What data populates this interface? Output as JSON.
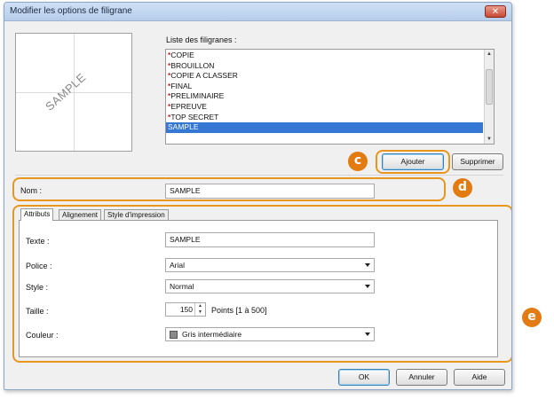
{
  "dialog": {
    "title": "Modifier les options de filigrane",
    "close_label": "✕"
  },
  "preview": {
    "watermark_text": "SAMPLE"
  },
  "watermark_list": {
    "label": "Liste des filigranes :",
    "items": [
      {
        "star": "*",
        "text": "COPIE"
      },
      {
        "star": "*",
        "text": "BROUILLON"
      },
      {
        "star": "*",
        "text": "COPIE A CLASSER"
      },
      {
        "star": "*",
        "text": "FINAL"
      },
      {
        "star": "*",
        "text": "PRELIMINAIRE"
      },
      {
        "star": "*",
        "text": "EPREUVE"
      },
      {
        "star": "*",
        "text": "TOP SECRET"
      },
      {
        "star": "",
        "text": "SAMPLE"
      }
    ],
    "selected_index": 7
  },
  "buttons": {
    "add": "Ajouter",
    "delete": "Supprimer",
    "ok": "OK",
    "cancel": "Annuler",
    "help": "Aide"
  },
  "badges": {
    "c": "c",
    "d": "d",
    "e": "e"
  },
  "name_field": {
    "label": "Nom :",
    "value": "SAMPLE"
  },
  "tabs": [
    {
      "label": "Attributs"
    },
    {
      "label": "Alignement"
    },
    {
      "label": "Style d'impression"
    }
  ],
  "attributes": {
    "text_label": "Texte :",
    "text_value": "SAMPLE",
    "font_label": "Police :",
    "font_value": "Arial",
    "style_label": "Style :",
    "style_value": "Normal",
    "size_label": "Taille :",
    "size_value": "150",
    "size_unit": "Points [1 à 500]",
    "color_label": "Couleur :",
    "color_value": "Gris intermédiaire"
  },
  "colors": {
    "highlight": "#e8961d",
    "badge": "#e37b13",
    "selection": "#3478d4",
    "required_star": "#d21f1f"
  }
}
